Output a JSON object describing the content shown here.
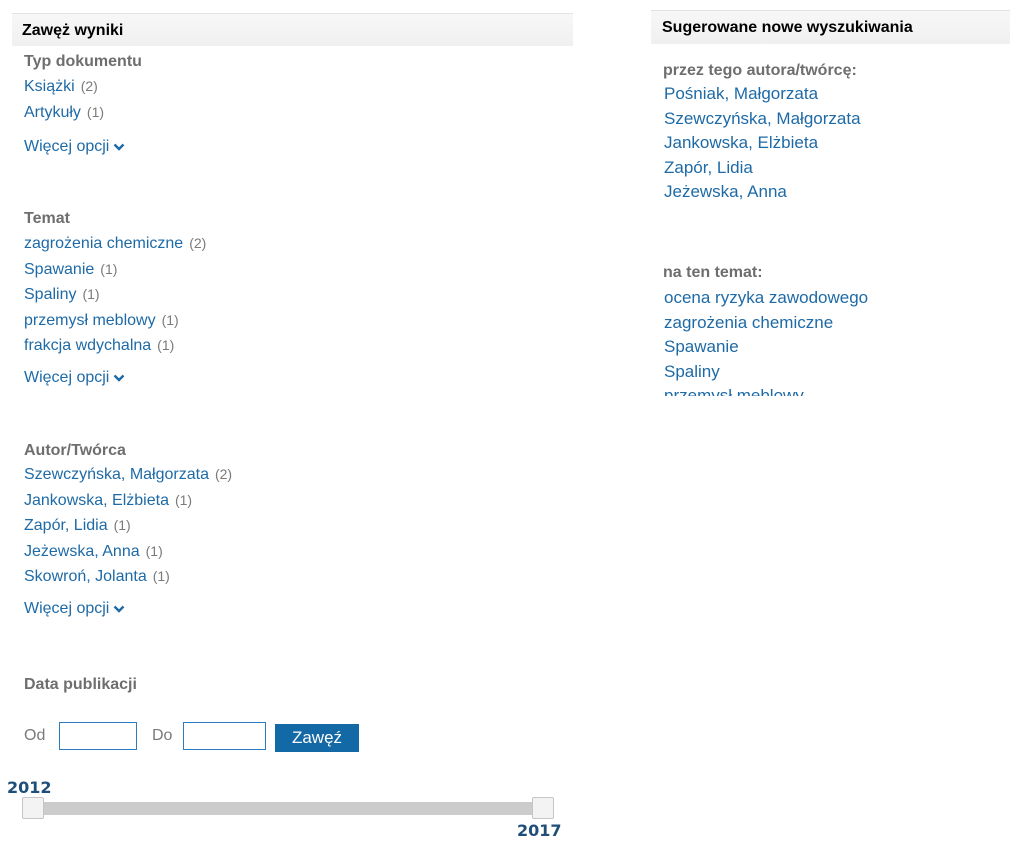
{
  "left_panel": {
    "title": "Zawęż wyniki",
    "doc_type": {
      "title": "Typ dokumentu",
      "items": [
        {
          "label": "Książki",
          "count": "(2)"
        },
        {
          "label": "Artykuły",
          "count": "(1)"
        }
      ],
      "more": "Więcej opcji"
    },
    "topic": {
      "title": "Temat",
      "items": [
        {
          "label": "zagrożenia chemiczne",
          "count": "(2)"
        },
        {
          "label": "Spawanie",
          "count": "(1)"
        },
        {
          "label": "Spaliny",
          "count": "(1)"
        },
        {
          "label": "przemysł meblowy",
          "count": "(1)"
        },
        {
          "label": "frakcja wdychalna",
          "count": "(1)"
        }
      ],
      "more": "Więcej opcji"
    },
    "author": {
      "title": "Autor/Twórca",
      "items": [
        {
          "label": "Szewczyńska, Małgorzata",
          "count": "(2)"
        },
        {
          "label": "Jankowska, Elżbieta",
          "count": "(1)"
        },
        {
          "label": "Zapór, Lidia",
          "count": "(1)"
        },
        {
          "label": "Jeżewska, Anna",
          "count": "(1)"
        },
        {
          "label": "Skowroń, Jolanta",
          "count": "(1)"
        }
      ],
      "more": "Więcej opcji"
    },
    "pub_date": {
      "title": "Data publikacji",
      "from_label": "Od",
      "from_value": "",
      "to_label": "Do",
      "to_value": "",
      "button": "Zawęź",
      "slider": {
        "min_label": "2012",
        "max_label": "2017",
        "min_value": 2012,
        "max_value": 2017
      }
    }
  },
  "right_panel": {
    "title": "Sugerowane nowe wyszukiwania",
    "by_author": {
      "title": "przez tego autora/twórcę:",
      "items": [
        "Pośniak, Małgorzata",
        "Szewczyńska, Małgorzata",
        "Jankowska, Elżbieta",
        "Zapór, Lidia",
        "Jeżewska, Anna"
      ]
    },
    "by_topic": {
      "title": "na ten temat:",
      "items": [
        "ocena ryzyka zawodowego",
        "zagrożenia chemiczne",
        "Spawanie",
        "Spaliny",
        "przemysł meblowy"
      ]
    }
  },
  "colors": {
    "link": "#1e6aa6",
    "button": "#1368a6",
    "heading": "#6e6e6e",
    "year_label": "#1f4e79"
  },
  "icons": {
    "more_chevron": "chevron-down-icon"
  }
}
